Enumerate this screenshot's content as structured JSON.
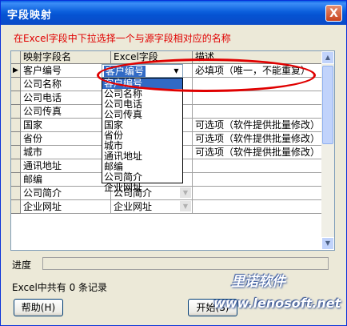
{
  "window": {
    "title": "字段映射",
    "close_glyph": "X"
  },
  "instruction": "在Excel字段中下拉选择一个与源字段相对应的名称",
  "grid": {
    "columns": [
      "映射字段名",
      "Excel字段",
      "描述"
    ],
    "current_row_marker": "▶",
    "rows": [
      {
        "field": "客户编号",
        "excel": "客户编号",
        "desc": "必填项（唯一，不能重复）"
      },
      {
        "field": "公司名称",
        "excel": "",
        "desc": ""
      },
      {
        "field": "公司电话",
        "excel": "",
        "desc": ""
      },
      {
        "field": "公司传真",
        "excel": "",
        "desc": ""
      },
      {
        "field": "国家",
        "excel": "",
        "desc": "可选项（软件提供批量修改）"
      },
      {
        "field": "省份",
        "excel": "",
        "desc": "可选项（软件提供批量修改）"
      },
      {
        "field": "城市",
        "excel": "",
        "desc": "可选项（软件提供批量修改）"
      },
      {
        "field": "通讯地址",
        "excel": "",
        "desc": ""
      },
      {
        "field": "邮编",
        "excel": "",
        "desc": ""
      },
      {
        "field": "公司简介",
        "excel": "公司简介",
        "desc": ""
      },
      {
        "field": "企业网址",
        "excel": "企业网址",
        "desc": ""
      }
    ],
    "dropdown_options": [
      "客户编号",
      "公司名称",
      "公司电话",
      "公司传真",
      "国家",
      "省份",
      "城市",
      "通讯地址",
      "邮编",
      "公司简介",
      "企业网址"
    ],
    "selected_option": "客户编号"
  },
  "progress": {
    "label": "进度",
    "value": 0
  },
  "record_count": "Excel中共有 0 条记录",
  "buttons": {
    "help": "帮助(H)",
    "start": "开始(S)"
  },
  "watermark": {
    "line1": "里诺软件",
    "line2": "www.lenosoft.net"
  },
  "colors": {
    "title_bar": "#0a5fe5",
    "instruction": "#e00000",
    "highlight": "#316ac5",
    "annotation": "#e00000"
  }
}
